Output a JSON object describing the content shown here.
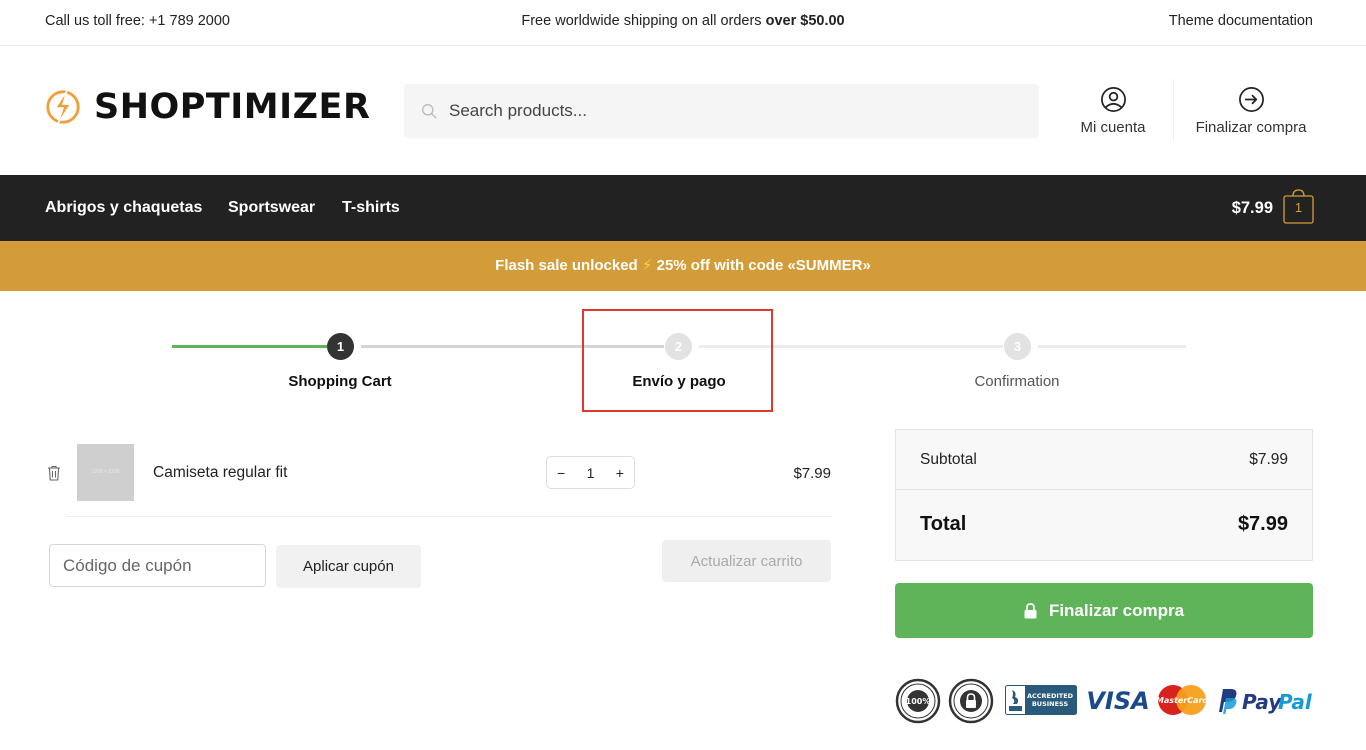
{
  "topbar": {
    "phone": "Call us toll free: +1 789 2000",
    "shipping_prefix": "Free worldwide shipping on all orders ",
    "shipping_bold": "over $50.00",
    "docs_link": "Theme documentation"
  },
  "header": {
    "logo_text": "SHOPTIMIZER",
    "search_placeholder": "Search products...",
    "account_label": "Mi cuenta",
    "checkout_label": "Finalizar compra"
  },
  "nav": {
    "items": [
      "Abrigos y chaquetas",
      "Sportswear",
      "T-shirts"
    ],
    "cart_total": "$7.99",
    "cart_count": "1"
  },
  "flash": {
    "prefix": "Flash sale unlocked ",
    "bolt": "⚡",
    "suffix": " 25% off with code «SUMMER»"
  },
  "steps": [
    {
      "number": "1",
      "label": "Shopping Cart",
      "state": "active"
    },
    {
      "number": "2",
      "label": "Envío y pago",
      "state": "upcoming"
    },
    {
      "number": "3",
      "label": "Confirmation",
      "state": "upcoming"
    }
  ],
  "cart": {
    "items": [
      {
        "name": "Camiseta regular fit",
        "thumb_text": "1200 × 1200",
        "quantity": "1",
        "price": "$7.99"
      }
    ],
    "qty_minus": "−",
    "qty_plus": "+",
    "coupon_placeholder": "Código de cupón",
    "apply_coupon": "Aplicar cupón",
    "update_cart": "Actualizar carrito"
  },
  "totals": {
    "subtotal_label": "Subtotal",
    "subtotal_value": "$7.99",
    "total_label": "Total",
    "total_value": "$7.99",
    "checkout_button": "Finalizar compra"
  },
  "badges": {
    "satisfaction": "100%",
    "bbb_line1": "ACCREDITED",
    "bbb_line2": "BUSINESS",
    "visa": "VISA",
    "mastercard": "MasterCard",
    "paypal_pay": "Pay",
    "paypal_pal": "Pal"
  },
  "colors": {
    "accent": "#d39c38",
    "nav_bg": "#222222",
    "checkout_green": "#5fb45a",
    "highlight_red": "#e0382b"
  }
}
